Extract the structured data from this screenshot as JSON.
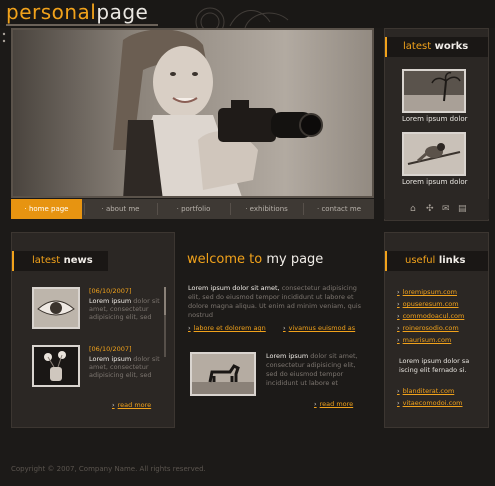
{
  "header": {
    "logo_part1": "personal",
    "logo_part2": "page"
  },
  "works": {
    "title_a": "latest",
    "title_b": "works",
    "items": [
      {
        "caption": "Lorem ipsum dolor"
      },
      {
        "caption": "Lorem ipsum dolor"
      }
    ]
  },
  "nav": {
    "items": [
      {
        "label": "home page"
      },
      {
        "label": "about me"
      },
      {
        "label": "portfolio"
      },
      {
        "label": "exhibitions"
      },
      {
        "label": "contact me"
      }
    ],
    "icons": [
      "home-icon",
      "sitemap-icon",
      "mail-icon",
      "print-icon"
    ]
  },
  "news": {
    "title_a": "latest",
    "title_b": "news",
    "items": [
      {
        "date": "[06/10/2007]",
        "lead": "Lorem ipsum",
        "text": "dolor sit amet, consectetur adipisicing elit, sed"
      },
      {
        "date": "[06/10/2007]",
        "lead": "Lorem ipsum",
        "text": "dolor sit amet, consectetur adipisicing elit, sed"
      }
    ],
    "more": "read more"
  },
  "welcome": {
    "title_a": "welcome to",
    "title_b": "my page",
    "intro_lead": "Lorem ipsum dolor sit amet,",
    "intro_text": "consectetur adipisicing elit, sed do eiusmod tempor incididunt ut labore et dolore magna aliqua. Ut enim ad minim veniam, quis nostrud",
    "link1": "labore et dolorem agn",
    "link2": "vivamus euismod as",
    "para_lead": "Lorem ipsum",
    "para_text": "dolor sit amet, consectetur adipisicing elit, sed do eiusmod tempor incididunt ut labore et",
    "more": "read more"
  },
  "links": {
    "title_a": "useful",
    "title_b": "links",
    "items": [
      {
        "label": "loremipsum.com"
      },
      {
        "label": "opuseresum.com"
      },
      {
        "label": "commodoacul.com"
      },
      {
        "label": "roinerosodio.com"
      },
      {
        "label": "maurisum.com"
      }
    ],
    "text": "Lorem ipsum dolor sa iscing elit fernado si.",
    "items2": [
      {
        "label": "blanditerat.com"
      },
      {
        "label": "vitaecomodoi.com"
      }
    ]
  },
  "footer": {
    "text": "Copyright © 2007, Company Name. All rights reserved."
  },
  "colors": {
    "accent": "#f1a21b",
    "background": "#1c1a18",
    "panel": "#2b2724"
  }
}
